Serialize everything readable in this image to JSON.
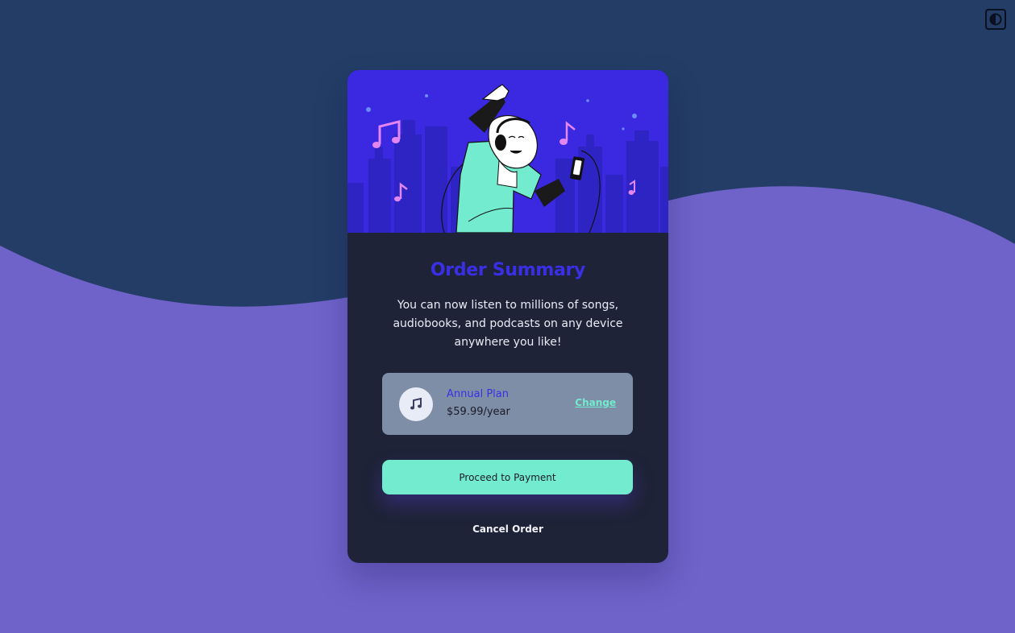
{
  "theme_toggle": {
    "icon": "contrast-icon"
  },
  "card": {
    "title": "Order Summary",
    "description": "You can now listen to millions of songs, audiobooks, and podcasts on any device anywhere you like!",
    "plan": {
      "icon": "music-note-icon",
      "name": "Annual Plan",
      "price": "$59.99/year",
      "change_label": "Change"
    },
    "proceed_label": "Proceed to Payment",
    "cancel_label": "Cancel Order"
  },
  "colors": {
    "background_top": "#233d66",
    "background_bottom": "#6f62c9",
    "card": "#1e2337",
    "accent_blue": "#3b2fe6",
    "accent_teal": "#72ebcf",
    "plan_panel": "#7e8ea6"
  }
}
